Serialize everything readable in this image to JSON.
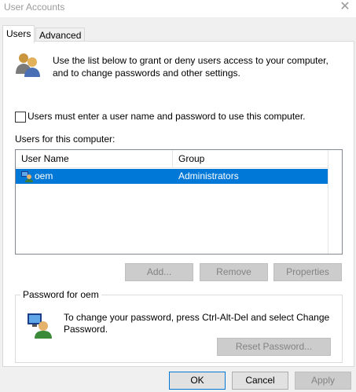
{
  "window": {
    "title": "User Accounts"
  },
  "tabs": [
    {
      "label": "Users"
    },
    {
      "label": "Advanced"
    }
  ],
  "intro_text": "Use the list below to grant or deny users access to your computer, and to change passwords and other settings.",
  "require_login": {
    "label": "Users must enter a user name and password to use this computer.",
    "checked": false
  },
  "users_label": "Users for this computer:",
  "table": {
    "columns": [
      "User Name",
      "Group"
    ],
    "rows": [
      {
        "user_name": "oem",
        "group": "Administrators",
        "selected": true
      }
    ]
  },
  "buttons": {
    "add": "Add...",
    "remove": "Remove",
    "properties": "Properties"
  },
  "password_group": {
    "title": "Password for oem",
    "text": "To change your password, press Ctrl-Alt-Del and select Change Password.",
    "reset_label": "Reset Password..."
  },
  "footer": {
    "ok": "OK",
    "cancel": "Cancel",
    "apply": "Apply"
  },
  "colors": {
    "selection": "#0078d7",
    "dialog_bg": "#f0f0f0"
  },
  "icons": [
    "users-icon",
    "user-row-icon",
    "password-user-icon",
    "close-icon"
  ]
}
